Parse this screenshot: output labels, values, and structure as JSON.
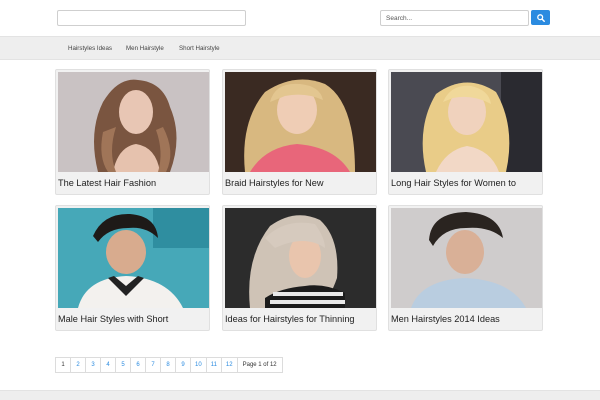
{
  "header": {
    "search_placeholder": "Search...",
    "search_icon": "search-icon"
  },
  "nav": {
    "items": [
      "Hairstyles Ideas",
      "Men Hairstyle",
      "Short Hairstyle"
    ]
  },
  "posts": [
    {
      "title": "The Latest Hair Fashion"
    },
    {
      "title": "Braid Hairstyles for New"
    },
    {
      "title": "Long Hair Styles for Women to"
    },
    {
      "title": "Male Hair Styles with Short"
    },
    {
      "title": "Ideas for Hairstyles for Thinning"
    },
    {
      "title": "Men Hairstyles 2014 Ideas"
    }
  ],
  "pagination": {
    "pages": [
      "1",
      "2",
      "3",
      "4",
      "5",
      "6",
      "7",
      "8",
      "9",
      "10",
      "11",
      "12"
    ],
    "info": "Page 1 of 12"
  },
  "colors": {
    "accent": "#2b8be0",
    "nav_bg": "#eeeeee"
  }
}
